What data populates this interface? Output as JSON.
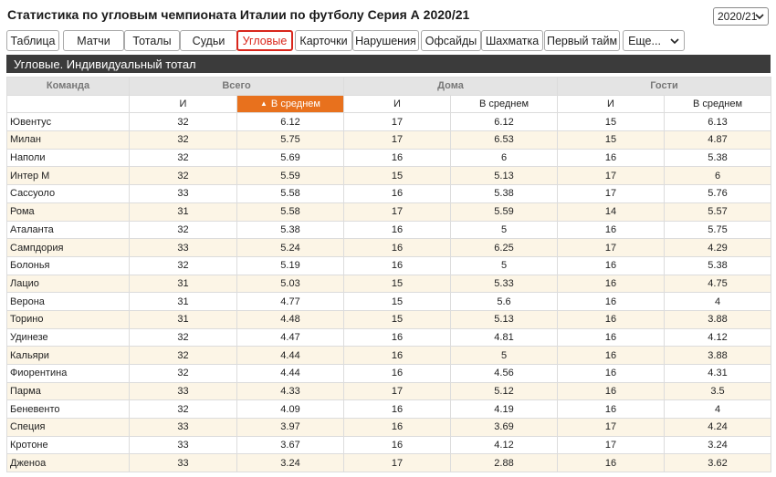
{
  "title": "Статистика по угловым чемпионата Италии по футболу Серия А 2020/21",
  "season_select": {
    "value": "2020/21",
    "icon": "chevron-down-icon"
  },
  "tabs": [
    {
      "label": "Таблица"
    },
    {
      "label": "Матчи"
    },
    {
      "label": "Тоталы"
    },
    {
      "label": "Судьи"
    },
    {
      "label": "Угловые",
      "active": true
    },
    {
      "label": "Карточки"
    },
    {
      "label": "Нарушения"
    },
    {
      "label": "Офсайды"
    },
    {
      "label": "Шахматка"
    },
    {
      "label": "Первый тайм"
    },
    {
      "label": "Еще...",
      "dropdown": true
    }
  ],
  "section_title": "Угловые. Индивидуальный тотал",
  "table": {
    "groups": {
      "team": "Команда",
      "total": "Всего",
      "home": "Дома",
      "away": "Гости"
    },
    "sub": {
      "games": "И",
      "avg": "В среднем"
    },
    "sort_icon": "sort-up-icon",
    "accent_color": "#e8711d",
    "rows": [
      {
        "team": "Ювентус",
        "g": "32",
        "avg": "6.12",
        "hg": "17",
        "havg": "6.12",
        "ag": "15",
        "aavg": "6.13"
      },
      {
        "team": "Милан",
        "g": "32",
        "avg": "5.75",
        "hg": "17",
        "havg": "6.53",
        "ag": "15",
        "aavg": "4.87"
      },
      {
        "team": "Наполи",
        "g": "32",
        "avg": "5.69",
        "hg": "16",
        "havg": "6",
        "ag": "16",
        "aavg": "5.38"
      },
      {
        "team": "Интер М",
        "g": "32",
        "avg": "5.59",
        "hg": "15",
        "havg": "5.13",
        "ag": "17",
        "aavg": "6"
      },
      {
        "team": "Сассуоло",
        "g": "33",
        "avg": "5.58",
        "hg": "16",
        "havg": "5.38",
        "ag": "17",
        "aavg": "5.76"
      },
      {
        "team": "Рома",
        "g": "31",
        "avg": "5.58",
        "hg": "17",
        "havg": "5.59",
        "ag": "14",
        "aavg": "5.57"
      },
      {
        "team": "Аталанта",
        "g": "32",
        "avg": "5.38",
        "hg": "16",
        "havg": "5",
        "ag": "16",
        "aavg": "5.75"
      },
      {
        "team": "Сампдория",
        "g": "33",
        "avg": "5.24",
        "hg": "16",
        "havg": "6.25",
        "ag": "17",
        "aavg": "4.29"
      },
      {
        "team": "Болонья",
        "g": "32",
        "avg": "5.19",
        "hg": "16",
        "havg": "5",
        "ag": "16",
        "aavg": "5.38"
      },
      {
        "team": "Лацио",
        "g": "31",
        "avg": "5.03",
        "hg": "15",
        "havg": "5.33",
        "ag": "16",
        "aavg": "4.75"
      },
      {
        "team": "Верона",
        "g": "31",
        "avg": "4.77",
        "hg": "15",
        "havg": "5.6",
        "ag": "16",
        "aavg": "4"
      },
      {
        "team": "Торино",
        "g": "31",
        "avg": "4.48",
        "hg": "15",
        "havg": "5.13",
        "ag": "16",
        "aavg": "3.88"
      },
      {
        "team": "Удинезе",
        "g": "32",
        "avg": "4.47",
        "hg": "16",
        "havg": "4.81",
        "ag": "16",
        "aavg": "4.12"
      },
      {
        "team": "Кальяри",
        "g": "32",
        "avg": "4.44",
        "hg": "16",
        "havg": "5",
        "ag": "16",
        "aavg": "3.88"
      },
      {
        "team": "Фиорентина",
        "g": "32",
        "avg": "4.44",
        "hg": "16",
        "havg": "4.56",
        "ag": "16",
        "aavg": "4.31"
      },
      {
        "team": "Парма",
        "g": "33",
        "avg": "4.33",
        "hg": "17",
        "havg": "5.12",
        "ag": "16",
        "aavg": "3.5"
      },
      {
        "team": "Беневенто",
        "g": "32",
        "avg": "4.09",
        "hg": "16",
        "havg": "4.19",
        "ag": "16",
        "aavg": "4"
      },
      {
        "team": "Специя",
        "g": "33",
        "avg": "3.97",
        "hg": "16",
        "havg": "3.69",
        "ag": "17",
        "aavg": "4.24"
      },
      {
        "team": "Кротоне",
        "g": "33",
        "avg": "3.67",
        "hg": "16",
        "havg": "4.12",
        "ag": "17",
        "aavg": "3.24"
      },
      {
        "team": "Дженоа",
        "g": "33",
        "avg": "3.24",
        "hg": "17",
        "havg": "2.88",
        "ag": "16",
        "aavg": "3.62"
      }
    ]
  }
}
